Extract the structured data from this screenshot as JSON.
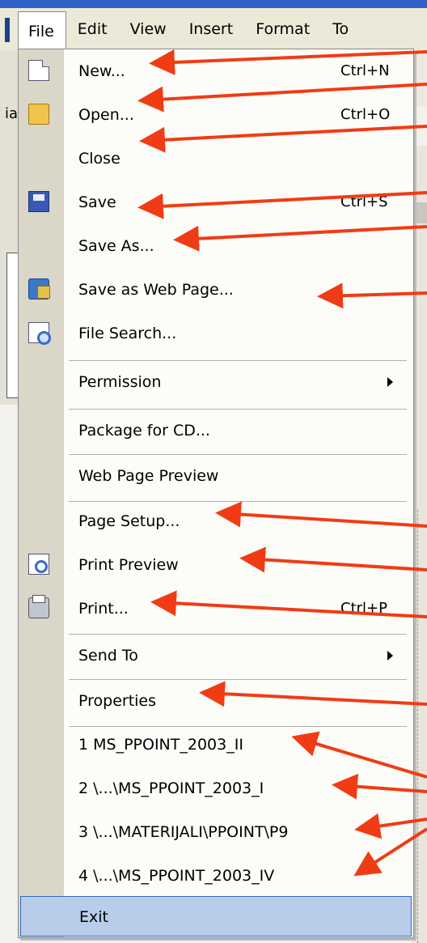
{
  "menubar": {
    "items": [
      "File",
      "Edit",
      "View",
      "Insert",
      "Format",
      "To"
    ]
  },
  "bg": {
    "left_char": "ia"
  },
  "menu": {
    "new": {
      "label": "New...",
      "shortcut": "Ctrl+N",
      "icon": "new-document-icon"
    },
    "open": {
      "label": "Open...",
      "shortcut": "Ctrl+O",
      "icon": "open-folder-icon"
    },
    "close": {
      "label": "Close"
    },
    "save": {
      "label": "Save",
      "shortcut": "Ctrl+S",
      "icon": "save-disk-icon"
    },
    "save_as": {
      "label": "Save As..."
    },
    "save_web": {
      "label": "Save as Web Page...",
      "icon": "web-page-icon"
    },
    "file_search": {
      "label": "File Search...",
      "icon": "file-search-icon"
    },
    "permission": {
      "label": "Permission"
    },
    "package_cd": {
      "label": "Package for CD..."
    },
    "web_preview": {
      "label": "Web Page Preview"
    },
    "page_setup": {
      "label": "Page Setup..."
    },
    "print_preview": {
      "label": "Print Preview",
      "icon": "print-preview-icon"
    },
    "print": {
      "label": "Print...",
      "shortcut": "Ctrl+P",
      "icon": "printer-icon"
    },
    "send_to": {
      "label": "Send To"
    },
    "properties": {
      "label": "Properties"
    },
    "recent": [
      "1 MS_PPOINT_2003_II",
      "2 \\...\\MS_PPOINT_2003_I",
      "3 \\...\\MATERIJALI\\PPOINT\\P9",
      "4 \\...\\MS_PPOINT_2003_IV"
    ],
    "exit": {
      "label": "Exit"
    }
  },
  "colors": {
    "menu_bg": "#fcfcf9",
    "gutter": "#dad6c8",
    "highlight": "#b9cdea",
    "highlight_border": "#3169c6",
    "annotation_arrow": "#f03c14"
  }
}
